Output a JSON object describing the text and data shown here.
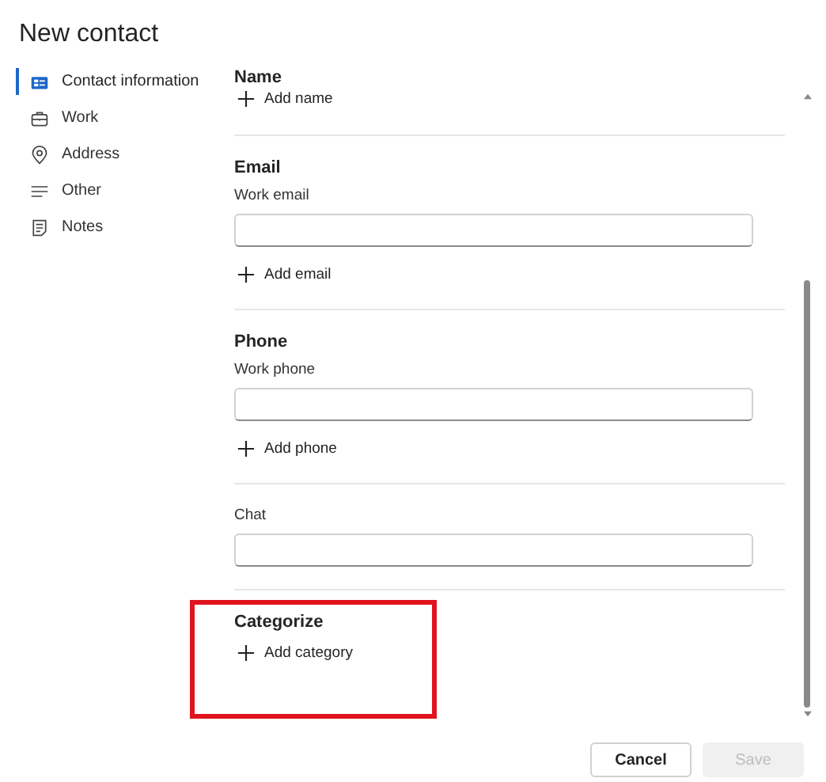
{
  "title": "New contact",
  "nav": [
    {
      "label": "Contact information",
      "kind": "card",
      "selected": true
    },
    {
      "label": "Work",
      "kind": "briefcase",
      "selected": false
    },
    {
      "label": "Address",
      "kind": "pin",
      "selected": false
    },
    {
      "label": "Other",
      "kind": "lines",
      "selected": false
    },
    {
      "label": "Notes",
      "kind": "note",
      "selected": false
    }
  ],
  "sections": [
    {
      "heading": "Name",
      "add": "Add name"
    },
    {
      "heading": "Email",
      "fields": [
        {
          "label": "Work email"
        }
      ],
      "add": "Add email"
    },
    {
      "heading": "Phone",
      "fields": [
        {
          "label": "Work phone"
        }
      ],
      "add": "Add phone"
    },
    {
      "fields": [
        {
          "label": "Chat"
        }
      ]
    },
    {
      "heading": "Categorize",
      "add": "Add category",
      "highlighted": true
    }
  ],
  "buttons": [
    {
      "label": "Cancel",
      "disabled": false
    },
    {
      "label": "Save",
      "disabled": true
    }
  ]
}
